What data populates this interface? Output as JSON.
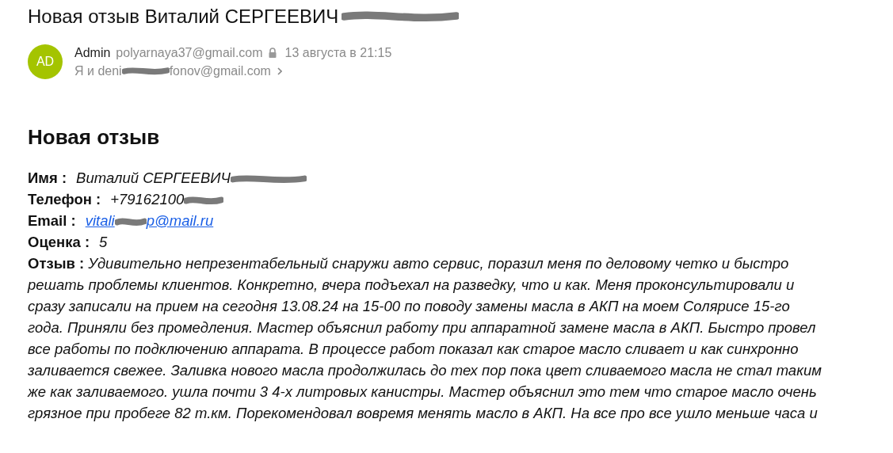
{
  "subject": {
    "text": "Новая отзыв Виталий СЕРГЕЕВИЧ",
    "redacted": true
  },
  "sender": {
    "avatar": "AD",
    "name": "Admin",
    "email": "polyarnaya37@gmail.com",
    "locked": true,
    "date": "13 августа в 21:15"
  },
  "recipients": {
    "prefix": "Я и deni",
    "suffix": "fonov@gmail.com",
    "expandable": true
  },
  "body": {
    "heading": "Новая отзыв",
    "fields": [
      {
        "kind": "text",
        "label": "Имя :",
        "value": "Виталий СЕРГЕЕВИЧ",
        "redacted": true
      },
      {
        "kind": "text",
        "label": "Телефон :",
        "value": "+79162100",
        "redacted": true
      },
      {
        "kind": "link",
        "label": "Email :",
        "value": "vitali",
        "value_end": "p@mail.ru",
        "redacted": true
      },
      {
        "kind": "text",
        "label": "Оценка :",
        "value": "5",
        "redacted": false
      }
    ],
    "review": {
      "text": "**Отзыв :** *Удивительно непрезентабельный снаружи авто сервис, поразил меня по деловому четко и быстро решать проблемы клиентов. Конкретно, вчера подъехал на разведку, что и как. Меня проконсультировали и сразу записали на прием на сегодня 13.08.24 на 15-00 по поводу замены масла в АКП на моем Солярисе 15-го года. Приняли без промедления. Мастер объяснил работу при аппаратной замене масла в АКП. Быстро провел все работы по подключению аппарата. В процессе работ показал как старое масло сливает и как синхронно заливается свежее. Заливка нового масла продолжилась до тех пор пока цвет сливаемого масла не стал таким же как заливаемого. ушла почти 3 4-х литровых канистры. Мастер объяснил это тем что старое масло очень грязное при пробеге 82 т.км. Порекомендовал вовремя менять масло в АКП. На все про все ушло меньше часа и*"
    }
  }
}
